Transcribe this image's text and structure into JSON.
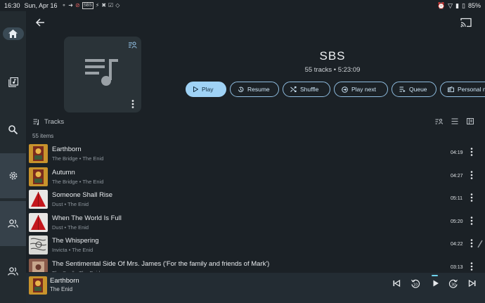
{
  "status": {
    "time": "16:30",
    "date": "Sun, Apr 16",
    "icons_left": [
      "bulb-icon",
      "arrow-icon",
      "no-icon",
      "sbs-icon",
      "flash-icon",
      "cross-icon",
      "check-icon",
      "tag-icon"
    ],
    "sbs_badge": "SBS",
    "battery": "85%"
  },
  "nav": {
    "items": [
      "home-icon",
      "library-icon",
      "search-icon",
      "settings-icon",
      "people-icon",
      "person-icon"
    ]
  },
  "playlist": {
    "title": "SBS",
    "subtitle": "55 tracks • 5:23:09"
  },
  "actions": [
    {
      "label": "Play",
      "icon": "play-icon"
    },
    {
      "label": "Resume",
      "icon": "history-icon"
    },
    {
      "label": "Shuffle",
      "icon": "shuffle-icon"
    },
    {
      "label": "Play next",
      "icon": "play-next-icon"
    },
    {
      "label": "Queue",
      "icon": "queue-icon"
    },
    {
      "label": "Personal m",
      "icon": "radio-icon"
    }
  ],
  "tracks_section": {
    "label": "Tracks",
    "count_text": "55 items"
  },
  "tracks": [
    {
      "title": "Earthborn",
      "sub": "The Bridge • The Enid",
      "duration": "04:19",
      "art": "bridge"
    },
    {
      "title": "Autumn",
      "sub": "The Bridge • The Enid",
      "duration": "04:27",
      "art": "bridge"
    },
    {
      "title": "Someone Shall Rise",
      "sub": "Dust • The Enid",
      "duration": "05:11",
      "art": "dust"
    },
    {
      "title": "When The World Is Full",
      "sub": "Dust • The Enid",
      "duration": "05:20",
      "art": "dust"
    },
    {
      "title": "The Whispering",
      "sub": "Invicta • The Enid",
      "duration": "04:22",
      "art": "invicta"
    },
    {
      "title": "The Sentimental Side Of Mrs. James ('For the family and friends of Mark')",
      "sub": "The Spell • The Enid",
      "duration": "03:13",
      "art": "spell"
    }
  ],
  "now_playing": {
    "title": "Earthborn",
    "artist": "The Enid"
  },
  "colors": {
    "accent": "#9fd2f5",
    "background": "#1b2126",
    "rail": "#232b30"
  }
}
